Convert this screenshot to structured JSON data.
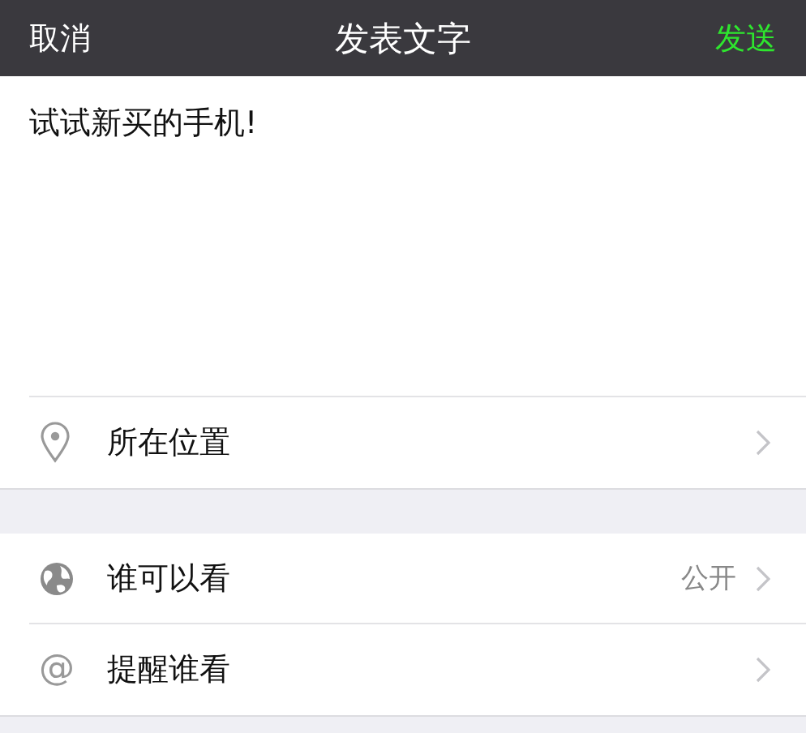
{
  "nav_bar": {
    "cancel": "取消",
    "title": "发表文字",
    "send": "发送"
  },
  "post": {
    "value": "试试新买的手机!"
  },
  "sections": [
    {
      "rows": [
        {
          "kind": "location",
          "label": "所在位置"
        }
      ]
    },
    {
      "rows": [
        {
          "kind": "visibility",
          "label": "谁可以看",
          "value": "公开"
        },
        {
          "kind": "mention",
          "icon_glyph": "@",
          "label": "提醒谁看"
        }
      ]
    }
  ]
}
